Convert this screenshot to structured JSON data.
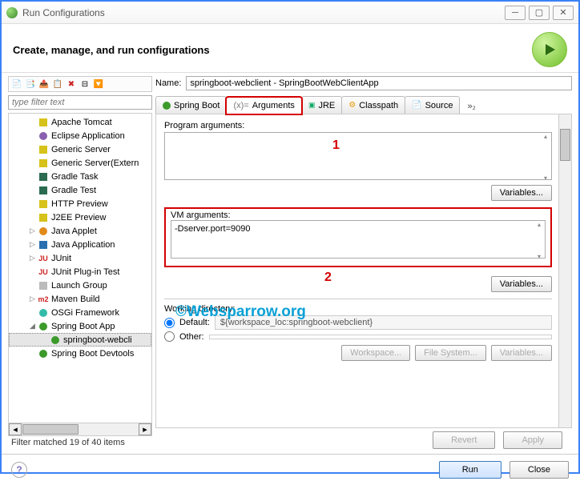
{
  "window_title": "Run Configurations",
  "header_title": "Create, manage, and run configurations",
  "filter_placeholder": "type filter text",
  "tree": [
    {
      "label": "Apache Tomcat",
      "icon": "server"
    },
    {
      "label": "Eclipse Application",
      "icon": "eclipse"
    },
    {
      "label": "Generic Server",
      "icon": "server"
    },
    {
      "label": "Generic Server(Extern",
      "icon": "server"
    },
    {
      "label": "Gradle Task",
      "icon": "gradle"
    },
    {
      "label": "Gradle Test",
      "icon": "gradle"
    },
    {
      "label": "HTTP Preview",
      "icon": "server"
    },
    {
      "label": "J2EE Preview",
      "icon": "server"
    },
    {
      "label": "Java Applet",
      "icon": "java-applet",
      "expand": "closed"
    },
    {
      "label": "Java Application",
      "icon": "java",
      "expand": "closed"
    },
    {
      "label": "JUnit",
      "icon": "junit",
      "expand": "closed"
    },
    {
      "label": "JUnit Plug-in Test",
      "icon": "junit-plugin"
    },
    {
      "label": "Launch Group",
      "icon": "launch-group"
    },
    {
      "label": "Maven Build",
      "icon": "maven",
      "expand": "closed"
    },
    {
      "label": "OSGi Framework",
      "icon": "osgi"
    },
    {
      "label": "Spring Boot App",
      "icon": "spring",
      "expand": "open"
    },
    {
      "label": "springboot-webcli",
      "icon": "spring",
      "indent": 2,
      "selected": true
    },
    {
      "label": "Spring Boot Devtools",
      "icon": "spring"
    }
  ],
  "filter_status": "Filter matched 19 of 40 items",
  "name_label": "Name:",
  "name_value": "springboot-webclient - SpringBootWebClientApp",
  "tabs": [
    {
      "label": "Spring Boot",
      "icon": "spring"
    },
    {
      "label": "Arguments",
      "icon": "args",
      "prefix": "(x)=",
      "selected": true
    },
    {
      "label": "JRE",
      "icon": "jre"
    },
    {
      "label": "Classpath",
      "icon": "classpath"
    },
    {
      "label": "Source",
      "icon": "source"
    }
  ],
  "tabs_more": "»₂",
  "program_args_label": "Program arguments:",
  "program_args_value": "",
  "vm_args_label": "VM arguments:",
  "vm_args_value": "-Dserver.port=9090",
  "variables_btn": "Variables...",
  "annotation_1": "1",
  "annotation_2": "2",
  "workdir_label": "Working directory:",
  "default_label": "Default:",
  "default_value": "${workspace_loc:springboot-webclient}",
  "other_label": "Other:",
  "workspace_btn": "Workspace...",
  "filesystem_btn": "File System...",
  "variables2_btn": "Variables...",
  "watermark": "©Websparrow.org",
  "revert_btn": "Revert",
  "apply_btn": "Apply",
  "run_btn": "Run",
  "close_btn": "Close"
}
